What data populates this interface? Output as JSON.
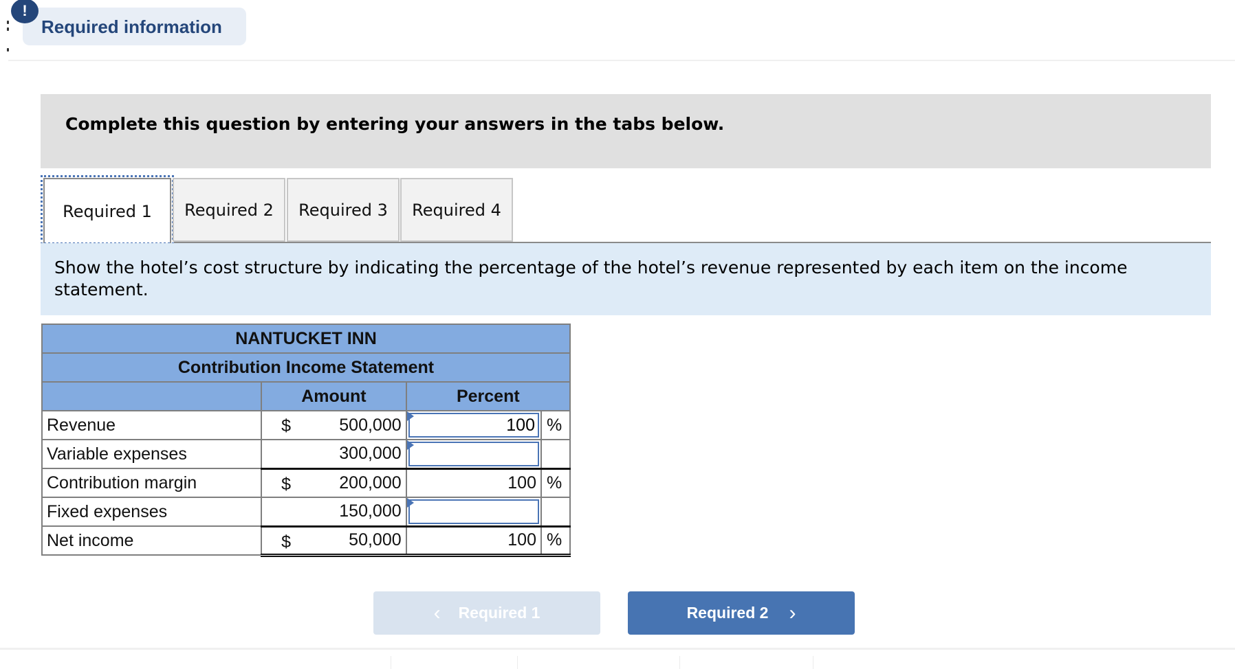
{
  "header": {
    "alert_glyph": "!",
    "required_info_label": "Required information"
  },
  "instructions": {
    "banner_text": "Complete this question by entering your answers in the tabs below."
  },
  "tabs": [
    {
      "label": "Required 1",
      "active": true
    },
    {
      "label": "Required 2",
      "active": false
    },
    {
      "label": "Required 3",
      "active": false
    },
    {
      "label": "Required 4",
      "active": false
    }
  ],
  "question": {
    "text": "Show the hotel’s cost structure by indicating the percentage of the hotel’s revenue represented by each item on the income statement."
  },
  "statement": {
    "company": "NANTUCKET INN",
    "title": "Contribution Income Statement",
    "col_amount": "Amount",
    "col_percent": "Percent",
    "rows": [
      {
        "label": "Revenue",
        "currency": "$",
        "amount": "500,000",
        "percent": "100",
        "percent_sign": "%",
        "editable": true
      },
      {
        "label": "Variable expenses",
        "currency": "",
        "amount": "300,000",
        "percent": "",
        "percent_sign": "",
        "editable": true
      },
      {
        "label": "Contribution margin",
        "currency": "$",
        "amount": "200,000",
        "percent": "100",
        "percent_sign": "%",
        "editable": false
      },
      {
        "label": "Fixed expenses",
        "currency": "",
        "amount": "150,000",
        "percent": "",
        "percent_sign": "",
        "editable": true
      },
      {
        "label": "Net income",
        "currency": "$",
        "amount": "50,000",
        "percent": "100",
        "percent_sign": "%",
        "editable": false
      }
    ]
  },
  "navigation": {
    "prev_label": "Required 1",
    "prev_icon": "chevron-left-icon",
    "prev_glyph": "‹",
    "next_label": "Required 2",
    "next_icon": "chevron-right-icon",
    "next_glyph": "›"
  }
}
